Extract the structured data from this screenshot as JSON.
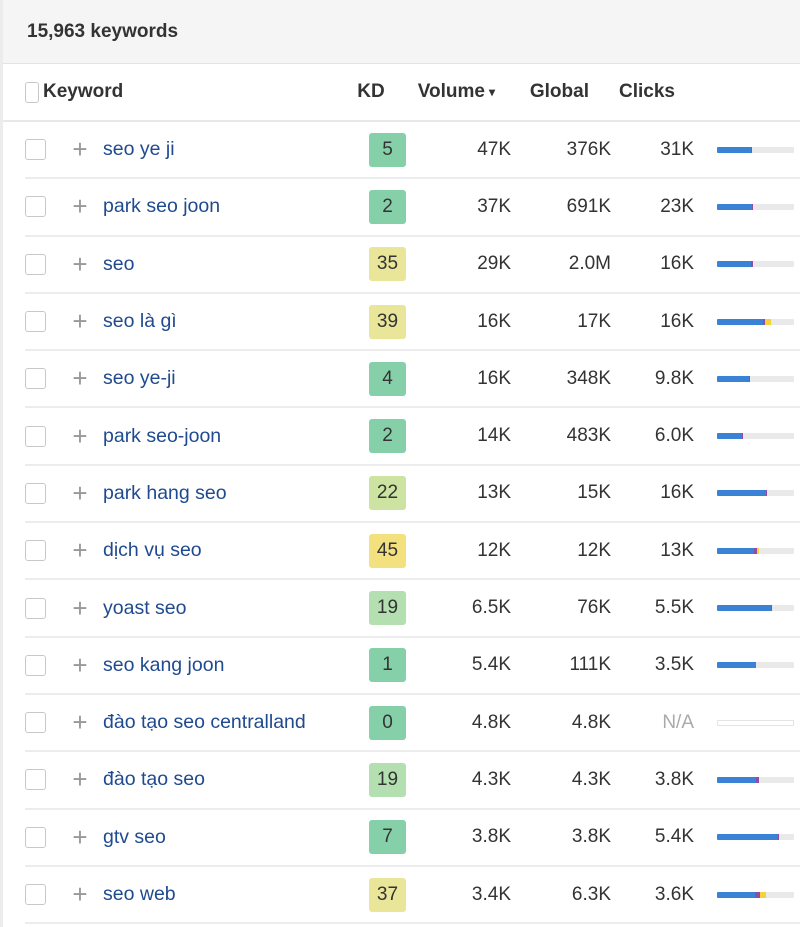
{
  "summary": {
    "count_label": "15,963 keywords"
  },
  "header": {
    "keyword": "Keyword",
    "kd": "KD",
    "volume": "Volume",
    "sort_icon": "▾",
    "global": "Global",
    "clicks": "Clicks"
  },
  "colors": {
    "kd_easy": "#86d0a9",
    "kd_light": "#b4dfb0",
    "kd_medium_low": "#cde3a2",
    "kd_medium": "#e9e69a",
    "kd_mid_high": "#f3e07f",
    "clicks_organic": "#3a82d6",
    "clicks_paid": "#8d4da8",
    "clicks_other": "#f4d23a",
    "keyword_link": "#1f4a8f"
  },
  "rows": [
    {
      "keyword": "seo ye ji",
      "kd": "5",
      "kd_color": "#86d0a9",
      "volume": "47K",
      "global": "376K",
      "clicks": "31K",
      "clicks_split": {
        "organic": 0.44,
        "paid": 0.02,
        "other": 0
      }
    },
    {
      "keyword": "park seo joon",
      "kd": "2",
      "kd_color": "#86d0a9",
      "volume": "37K",
      "global": "691K",
      "clicks": "23K",
      "clicks_split": {
        "organic": 0.46,
        "paid": 0.01,
        "other": 0
      }
    },
    {
      "keyword": "seo",
      "kd": "35",
      "kd_color": "#e9e69a",
      "volume": "29K",
      "global": "2.0M",
      "clicks": "16K",
      "clicks_split": {
        "organic": 0.44,
        "paid": 0.03,
        "other": 0
      }
    },
    {
      "keyword": "seo là gì",
      "kd": "39",
      "kd_color": "#e9e69a",
      "volume": "16K",
      "global": "17K",
      "clicks": "16K",
      "clicks_split": {
        "organic": 0.6,
        "paid": 0.03,
        "other": 0.07
      }
    },
    {
      "keyword": "seo ye-ji",
      "kd": "4",
      "kd_color": "#86d0a9",
      "volume": "16K",
      "global": "348K",
      "clicks": "9.8K",
      "clicks_split": {
        "organic": 0.42,
        "paid": 0.01,
        "other": 0
      }
    },
    {
      "keyword": "park seo-joon",
      "kd": "2",
      "kd_color": "#86d0a9",
      "volume": "14K",
      "global": "483K",
      "clicks": "6.0K",
      "clicks_split": {
        "organic": 0.32,
        "paid": 0.01,
        "other": 0
      }
    },
    {
      "keyword": "park hang seo",
      "kd": "22",
      "kd_color": "#cde3a2",
      "volume": "13K",
      "global": "15K",
      "clicks": "16K",
      "clicks_split": {
        "organic": 0.63,
        "paid": 0.01,
        "other": 0
      }
    },
    {
      "keyword": "dịch vụ seo",
      "kd": "45",
      "kd_color": "#f3e07f",
      "volume": "12K",
      "global": "12K",
      "clicks": "13K",
      "clicks_split": {
        "organic": 0.48,
        "paid": 0.04,
        "other": 0.03
      }
    },
    {
      "keyword": "yoast seo",
      "kd": "19",
      "kd_color": "#b4dfb0",
      "volume": "6.5K",
      "global": "76K",
      "clicks": "5.5K",
      "clicks_split": {
        "organic": 0.7,
        "paid": 0.02,
        "other": 0
      }
    },
    {
      "keyword": "seo kang joon",
      "kd": "1",
      "kd_color": "#86d0a9",
      "volume": "5.4K",
      "global": "111K",
      "clicks": "3.5K",
      "clicks_split": {
        "organic": 0.5,
        "paid": 0,
        "other": 0
      }
    },
    {
      "keyword": "đào tạo seo centralland",
      "kd": "0",
      "kd_color": "#86d0a9",
      "volume": "4.8K",
      "global": "4.8K",
      "clicks": "N/A",
      "clicks_split": null
    },
    {
      "keyword": "đào tạo seo",
      "kd": "19",
      "kd_color": "#b4dfb0",
      "volume": "4.3K",
      "global": "4.3K",
      "clicks": "3.8K",
      "clicks_split": {
        "organic": 0.5,
        "paid": 0.04,
        "other": 0
      }
    },
    {
      "keyword": "gtv seo",
      "kd": "7",
      "kd_color": "#86d0a9",
      "volume": "3.8K",
      "global": "3.8K",
      "clicks": "5.4K",
      "clicks_split": {
        "organic": 0.79,
        "paid": 0.01,
        "other": 0
      }
    },
    {
      "keyword": "seo web",
      "kd": "37",
      "kd_color": "#e9e69a",
      "volume": "3.4K",
      "global": "6.3K",
      "clicks": "3.6K",
      "clicks_split": {
        "organic": 0.49,
        "paid": 0.07,
        "other": 0.08
      }
    }
  ]
}
